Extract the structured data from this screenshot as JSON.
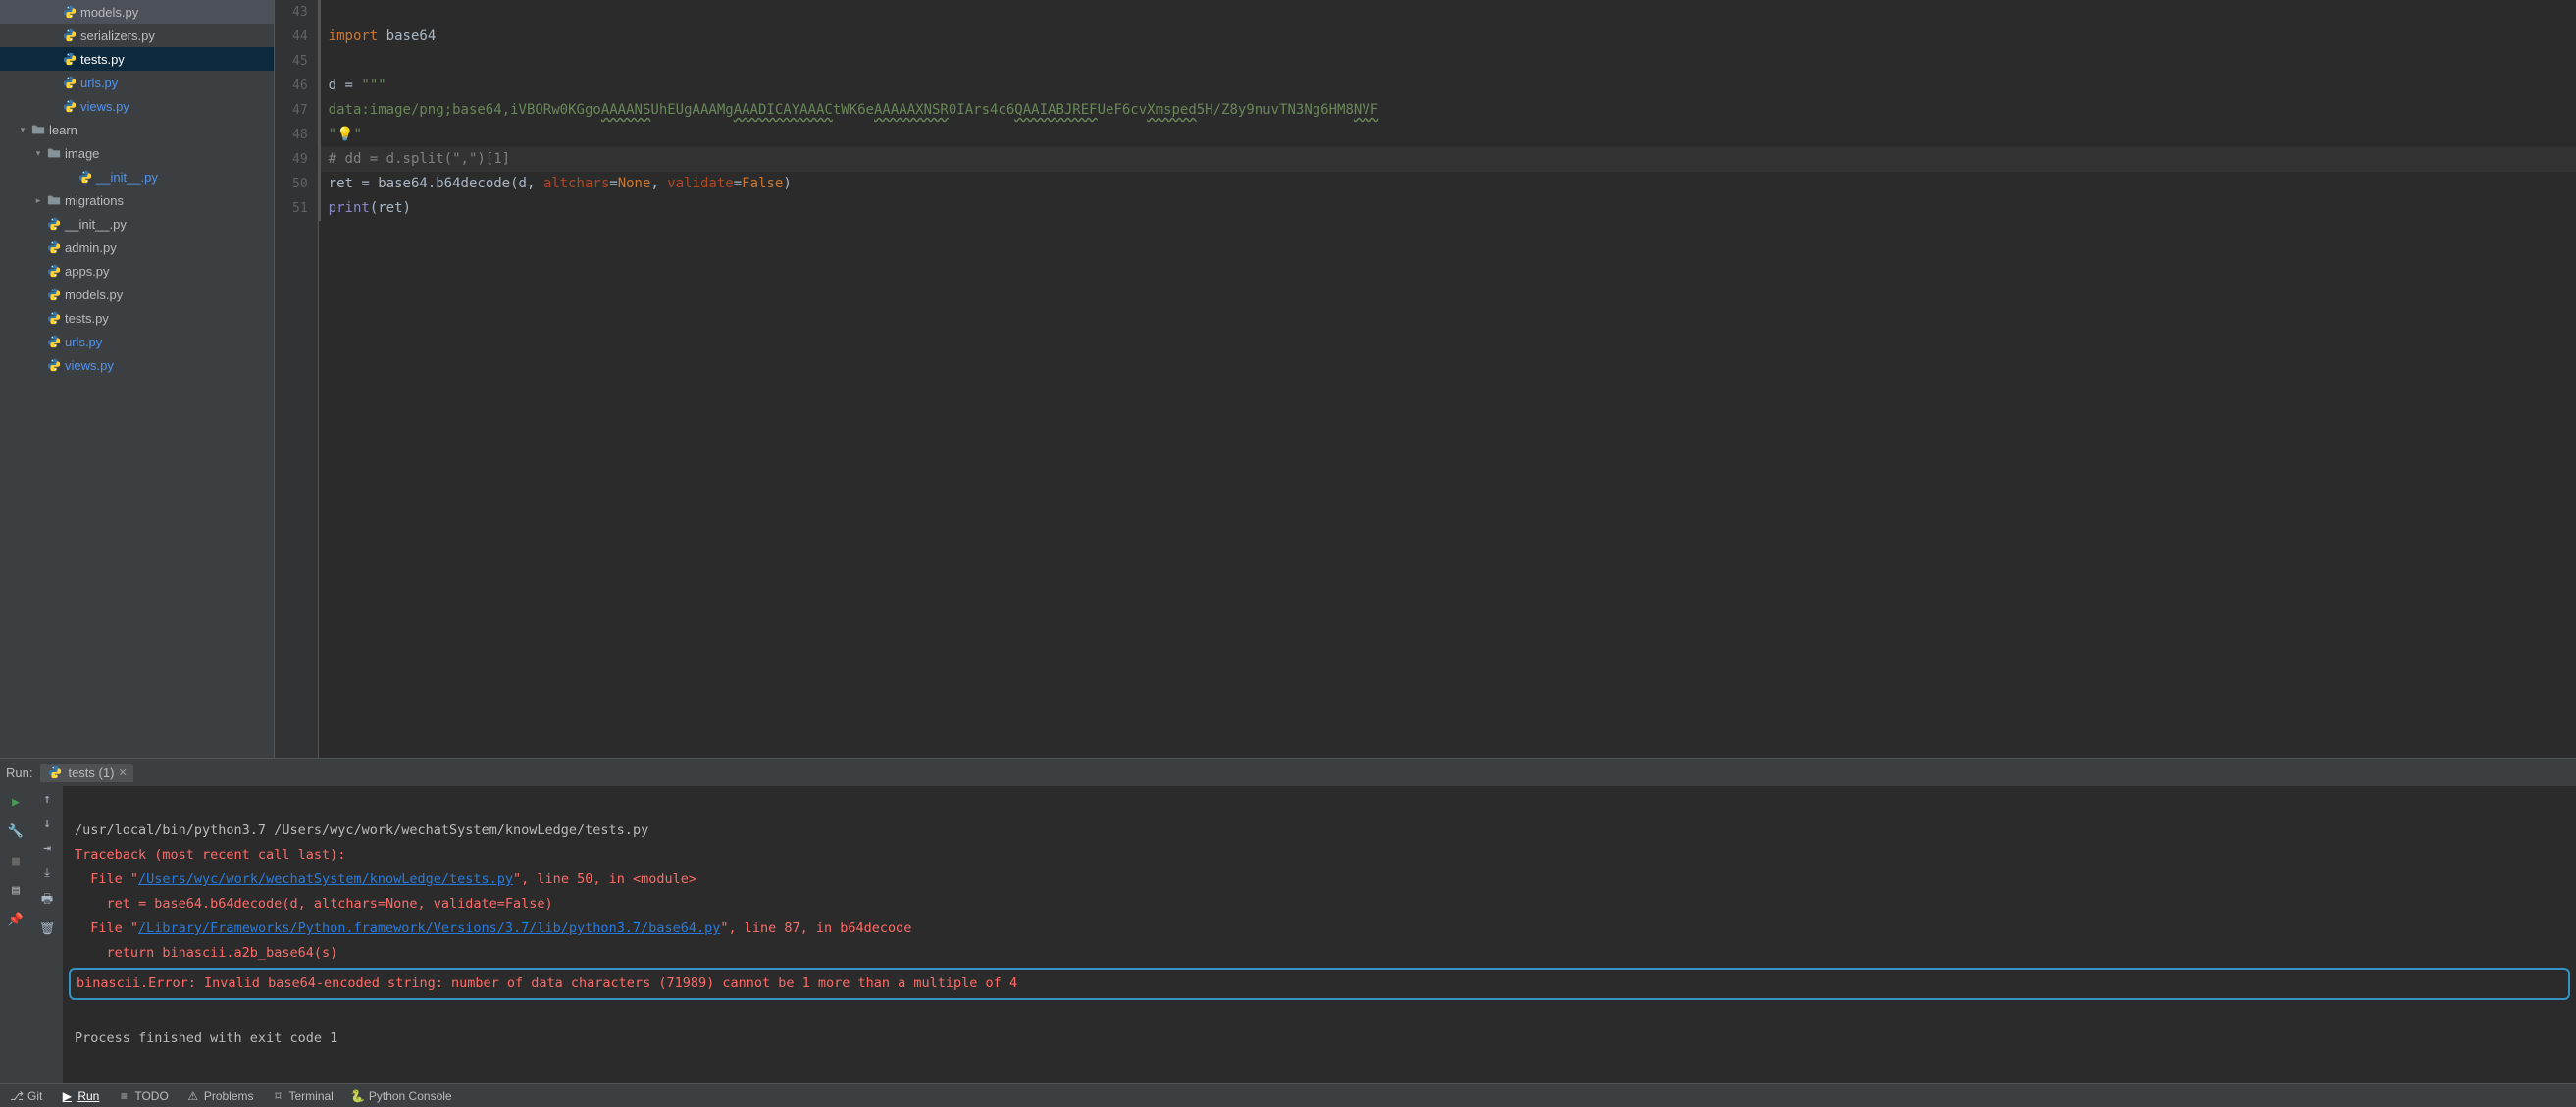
{
  "sidebar": {
    "items": [
      {
        "indent": 3,
        "chevron": "none",
        "icon": "py",
        "label": "models.py",
        "hl": false
      },
      {
        "indent": 3,
        "chevron": "none",
        "icon": "py",
        "label": "serializers.py",
        "hl": false
      },
      {
        "indent": 3,
        "chevron": "none",
        "icon": "py",
        "label": "tests.py",
        "hl": false,
        "selected": true
      },
      {
        "indent": 3,
        "chevron": "none",
        "icon": "py",
        "label": "urls.py",
        "hl": true
      },
      {
        "indent": 3,
        "chevron": "none",
        "icon": "py",
        "label": "views.py",
        "hl": true
      },
      {
        "indent": 1,
        "chevron": "down",
        "icon": "folder",
        "label": "learn",
        "hl": false
      },
      {
        "indent": 2,
        "chevron": "down",
        "icon": "folder",
        "label": "image",
        "hl": false
      },
      {
        "indent": 4,
        "chevron": "none",
        "icon": "py",
        "label": "__init__.py",
        "hl": true
      },
      {
        "indent": 2,
        "chevron": "right",
        "icon": "folder",
        "label": "migrations",
        "hl": false
      },
      {
        "indent": 2,
        "chevron": "none",
        "icon": "py",
        "label": "__init__.py",
        "hl": false
      },
      {
        "indent": 2,
        "chevron": "none",
        "icon": "py",
        "label": "admin.py",
        "hl": false
      },
      {
        "indent": 2,
        "chevron": "none",
        "icon": "py",
        "label": "apps.py",
        "hl": false
      },
      {
        "indent": 2,
        "chevron": "none",
        "icon": "py",
        "label": "models.py",
        "hl": false
      },
      {
        "indent": 2,
        "chevron": "none",
        "icon": "py",
        "label": "tests.py",
        "hl": false
      },
      {
        "indent": 2,
        "chevron": "none",
        "icon": "py",
        "label": "urls.py",
        "hl": true
      },
      {
        "indent": 2,
        "chevron": "none",
        "icon": "py",
        "label": "views.py",
        "hl": true
      }
    ]
  },
  "editor": {
    "line_start": 43,
    "lines": [
      {
        "n": 43,
        "html": ""
      },
      {
        "n": 44,
        "html": "<span class='kw'>import</span> <span class='ident'>base64</span>"
      },
      {
        "n": 45,
        "html": ""
      },
      {
        "n": 46,
        "html": "<span class='ident'>d</span> = <span class='str'>\"\"\"</span>"
      },
      {
        "n": 47,
        "html": "<span class='str'>data:image/png;base64,iVBORw0KGgo<span class='under'>AAAANS</span>UhEUgAAAMg<span class='under'>AAADICAYAAAC</span>tWK6e<span class='under'>AAAAAXNSR</span>0IArs4c6<span class='under'>QAAIABJREF</span>UeF6cv<span class='under'>Xmsped</span>5H/Z8y9nuvTN3Ng6HM8<span class='under'>NVF</span></span>"
      },
      {
        "n": 48,
        "html": "<span class='str'>\"</span><span class='bulb'>💡</span><span class='str'>\"</span>"
      },
      {
        "n": 49,
        "html": "<span class='comment'># dd = d.split(\",\")[1]</span>",
        "caret": true
      },
      {
        "n": 50,
        "html": "<span class='ident'>ret</span> = base64.b64decode(d, <span class='param'>altchars</span>=<span class='kw'>None</span>, <span class='param'>validate</span>=<span class='kw'>False</span>)"
      },
      {
        "n": 51,
        "html": "<span class='builtin'>print</span>(ret<span class='ident'>)</span>"
      }
    ]
  },
  "run": {
    "label": "Run:",
    "tab_name": "tests (1)",
    "output": {
      "cmd": "/usr/local/bin/python3.7 /Users/wyc/work/wechatSystem/knowLedge/tests.py",
      "traceback_header": "Traceback (most recent call last):",
      "frame1_prefix": "  File \"",
      "frame1_link": "/Users/wyc/work/wechatSystem/knowLedge/tests.py",
      "frame1_suffix": "\", line 50, in <module>",
      "frame1_code": "    ret = base64.b64decode(d, altchars=None, validate=False)",
      "frame2_prefix": "  File \"",
      "frame2_link": "/Library/Frameworks/Python.framework/Versions/3.7/lib/python3.7/base64.py",
      "frame2_suffix": "\", line 87, in b64decode",
      "frame2_code": "    return binascii.a2b_base64(s)",
      "error": "binascii.Error: Invalid base64-encoded string: number of data characters (71989) cannot be 1 more than a multiple of 4",
      "exit": "Process finished with exit code 1"
    }
  },
  "bottom_bar": {
    "items": [
      {
        "icon": "git",
        "label": "Git"
      },
      {
        "icon": "play",
        "label": "Run",
        "active": true
      },
      {
        "icon": "todo",
        "label": "TODO"
      },
      {
        "icon": "problems",
        "label": "Problems"
      },
      {
        "icon": "terminal",
        "label": "Terminal"
      },
      {
        "icon": "python",
        "label": "Python Console"
      }
    ]
  }
}
